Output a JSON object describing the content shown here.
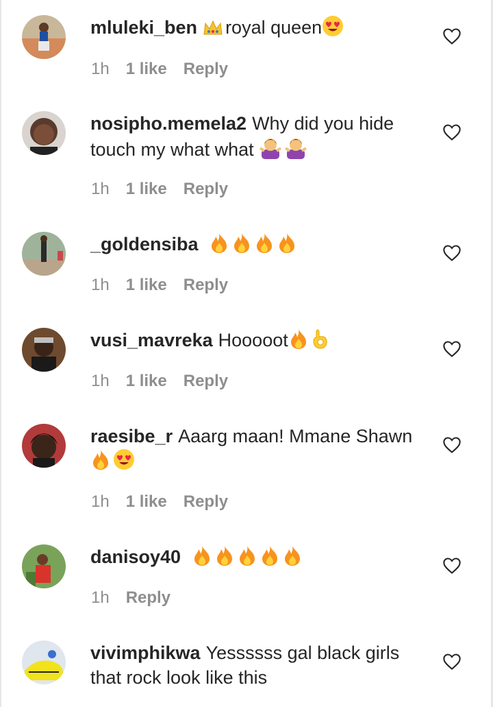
{
  "comments": [
    {
      "username": "mluleki_ben",
      "text": "royal queen",
      "emojis_before": [
        "crown"
      ],
      "emojis_after": [
        "heart-eyes"
      ],
      "time": "1h",
      "likes": "1 like",
      "reply": "Reply"
    },
    {
      "username": "nosipho.memela2",
      "text": "Why did you hide touch my what what",
      "emojis_after": [
        "shrug",
        "shrug"
      ],
      "time": "1h",
      "likes": "1 like",
      "reply": "Reply"
    },
    {
      "username": "_goldensiba",
      "text": "",
      "emojis_after": [
        "fire",
        "fire",
        "fire",
        "fire"
      ],
      "time": "1h",
      "likes": "1 like",
      "reply": "Reply"
    },
    {
      "username": "vusi_mavreka",
      "text": "Hooooot",
      "emojis_after": [
        "fire",
        "ok-hand"
      ],
      "time": "1h",
      "likes": "1 like",
      "reply": "Reply"
    },
    {
      "username": "raesibe_r",
      "text": "Aaarg maan! Mmane Shawn",
      "emojis_after": [
        "fire",
        "heart-eyes"
      ],
      "time": "1h",
      "likes": "1 like",
      "reply": "Reply"
    },
    {
      "username": "danisoy40",
      "text": "",
      "emojis_after": [
        "fire",
        "fire",
        "fire",
        "fire",
        "fire"
      ],
      "time": "1h",
      "likes": "",
      "reply": "Reply"
    },
    {
      "username": "vivimphikwa",
      "text": "Yessssss gal black girls that rock look like this",
      "emojis_after": [],
      "time": "",
      "likes": "",
      "reply": ""
    }
  ],
  "colors": {
    "text": "#262626",
    "meta": "#8e8e8e",
    "heart_outline": "#262626",
    "fire": "#f7931e",
    "emoji_face": "#ffcc33",
    "heart_eyes": "#e8264b",
    "shrug_purple": "#8e44ad"
  },
  "icons": [
    "heart-outline-icon",
    "fire-emoji",
    "heart-eyes-emoji",
    "crown-emoji",
    "shrug-emoji",
    "ok-hand-emoji"
  ]
}
